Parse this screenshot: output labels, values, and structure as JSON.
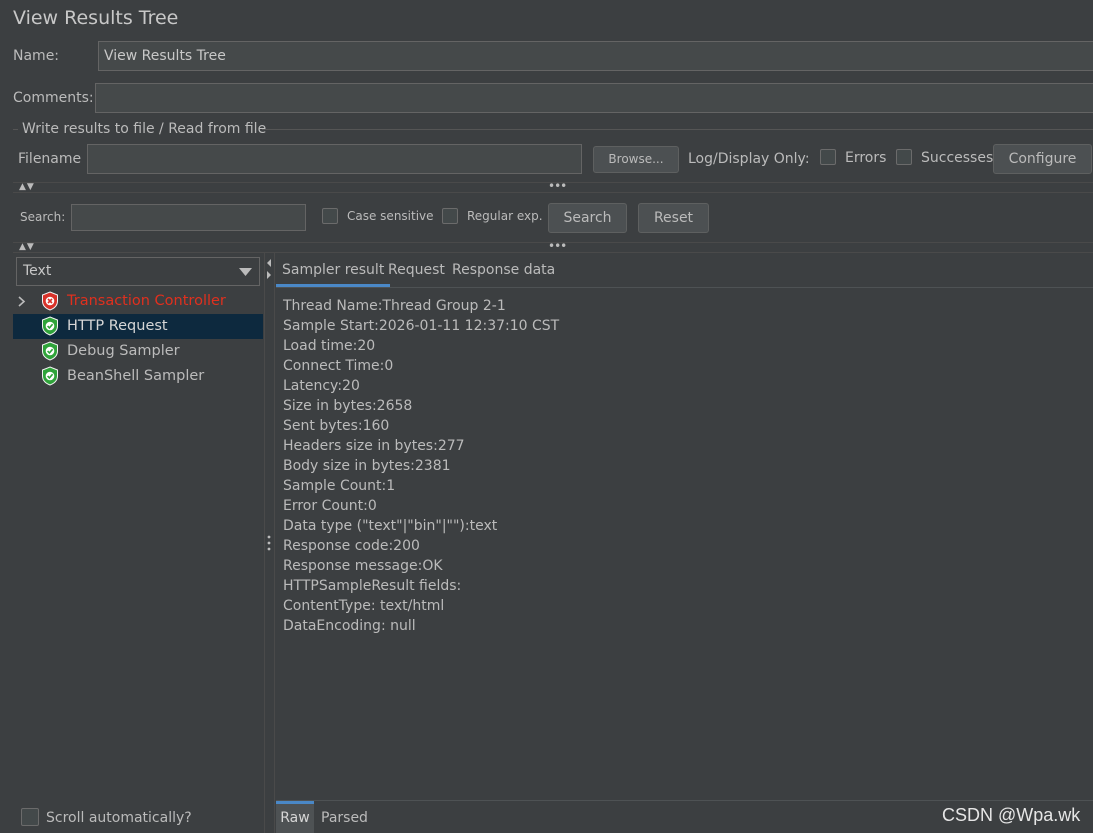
{
  "window": {
    "title": "View Results Tree"
  },
  "name_field": {
    "label": "Name:",
    "value": "View Results Tree"
  },
  "comments_field": {
    "label": "Comments:",
    "value": ""
  },
  "file_section": {
    "legend": "Write results to file / Read from file",
    "filename_label": "Filename",
    "filename_value": "",
    "browse_label": "Browse...",
    "log_display_label": "Log/Display Only:",
    "errors_label": "Errors",
    "successes_label": "Successes",
    "configure_label": "Configure"
  },
  "search_bar": {
    "label": "Search:",
    "value": "",
    "case_sensitive_label": "Case sensitive",
    "regular_exp_label": "Regular exp.",
    "search_label": "Search",
    "reset_label": "Reset"
  },
  "renderer_select": {
    "selected": "Text"
  },
  "tree": {
    "items": [
      {
        "label": "Transaction Controller",
        "status": "error",
        "color": "#e0301e"
      },
      {
        "label": "HTTP Request",
        "status": "success",
        "selected": true
      },
      {
        "label": "Debug Sampler",
        "status": "success"
      },
      {
        "label": "BeanShell Sampler",
        "status": "success"
      }
    ]
  },
  "scroll_auto_label": "Scroll automatically?",
  "result_tabs": [
    "Sampler result",
    "Request",
    "Response data"
  ],
  "sampler_result_lines": [
    "Thread Name:Thread Group 2-1",
    "Sample Start:2026-01-11 12:37:10 CST",
    "Load time:20",
    "Connect Time:0",
    "Latency:20",
    "Size in bytes:2658",
    "Sent bytes:160",
    "Headers size in bytes:277",
    "Body size in bytes:2381",
    "Sample Count:1",
    "Error Count:0",
    "Data type (\"text\"|\"bin\"|\"\"):text",
    "Response code:200",
    "Response message:OK",
    "",
    "",
    "HTTPSampleResult fields:",
    "ContentType: text/html",
    "DataEncoding: null"
  ],
  "bottom_tabs": [
    "Raw",
    "Parsed"
  ],
  "watermark": "CSDN @Wpa.wk",
  "colors": {
    "background": "#3c3f41",
    "accent_tab": "#4a88c7",
    "selected_row": "#0d293e",
    "success_icon": "#2fa33a",
    "error_icon": "#d8322a"
  }
}
